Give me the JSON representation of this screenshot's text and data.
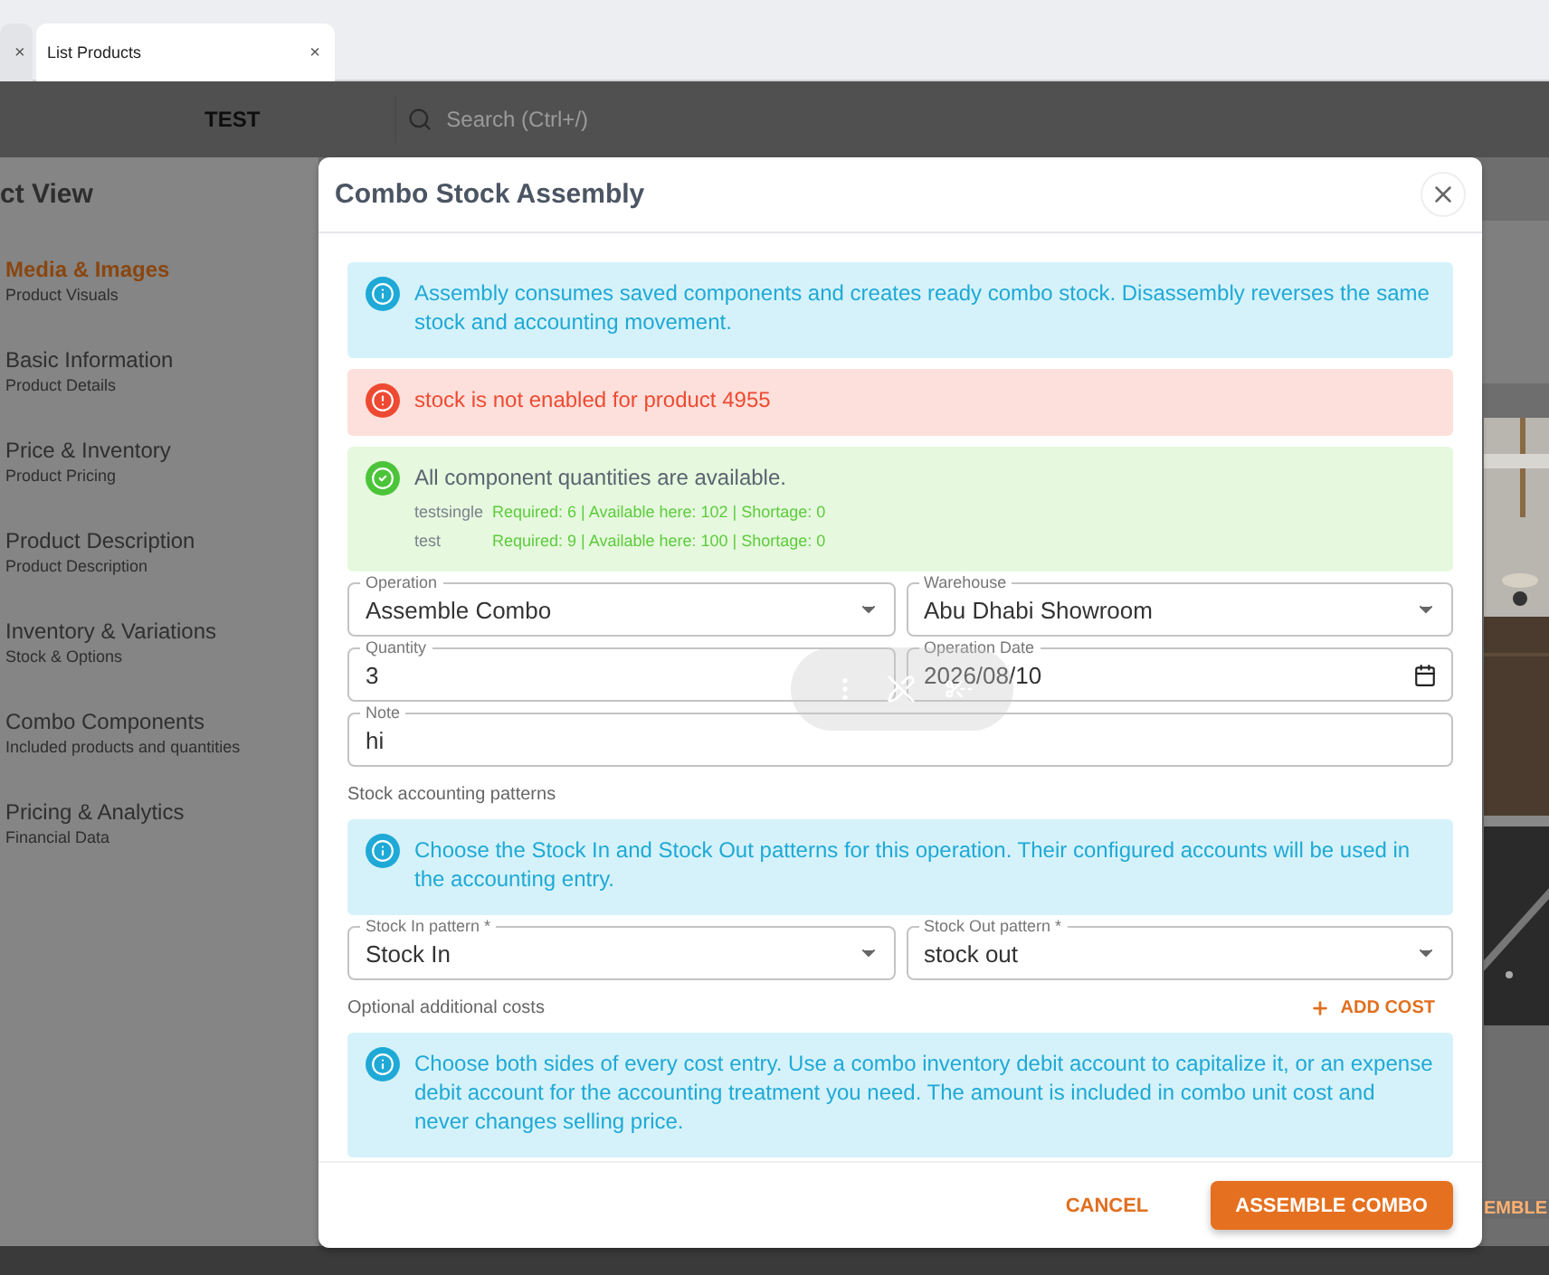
{
  "browser_tabs": [
    {
      "close_glyph": "×",
      "selected": false
    },
    {
      "label": "List Products",
      "close_glyph": "×",
      "selected": true
    }
  ],
  "header": {
    "title": "TEST",
    "search_placeholder": "Search (Ctrl+/)"
  },
  "page": {
    "heading": "ct View",
    "button_fragment": "EMBLE",
    "sections": [
      {
        "title": "Media & Images",
        "subtitle": "Product Visuals",
        "selected": true
      },
      {
        "title": "Basic Information",
        "subtitle": "Product Details",
        "selected": false
      },
      {
        "title": "Price & Inventory",
        "subtitle": "Product Pricing",
        "selected": false
      },
      {
        "title": "Product Description",
        "subtitle": "Product Description",
        "selected": false
      },
      {
        "title": "Inventory & Variations",
        "subtitle": "Stock & Options",
        "selected": false
      },
      {
        "title": "Combo Components",
        "subtitle": "Included products and quantities",
        "selected": false
      },
      {
        "title": "Pricing & Analytics",
        "subtitle": "Financial Data",
        "selected": false
      }
    ]
  },
  "dialog": {
    "title": "Combo Stock Assembly",
    "blocks": [
      {
        "kind": "info_alert",
        "text": "Assembly consumes saved components and creates ready combo stock. Disassembly reverses the same stock and accounting movement."
      },
      {
        "kind": "error_alert",
        "text": "stock is not enabled for product 4955"
      },
      {
        "kind": "success_alert",
        "text": "All component quantities are available.",
        "lines": [
          {
            "name": "testsingle",
            "detail": "Required: 6 | Available here: 102 | Shortage: 0"
          },
          {
            "name": "test",
            "detail": "Required: 9 | Available here: 100 | Shortage: 0"
          }
        ]
      },
      {
        "kind": "fields",
        "fields": [
          {
            "label": "Operation",
            "value": "Assemble Combo",
            "kind": "select"
          },
          {
            "label": "Warehouse",
            "value": "Abu Dhabi Showroom",
            "kind": "select"
          }
        ]
      },
      {
        "kind": "fields",
        "fields": [
          {
            "label": "Quantity",
            "value": "3",
            "kind": "text"
          },
          {
            "label": "Operation Date",
            "value": "2026/08/10",
            "kind": "date"
          }
        ]
      },
      {
        "kind": "fields",
        "fields": [
          {
            "label": "Note",
            "value": "hi",
            "kind": "text"
          }
        ]
      },
      {
        "kind": "heading",
        "text": "Stock accounting patterns"
      },
      {
        "kind": "info_alert",
        "text": "Choose the Stock In and Stock Out patterns for this operation. Their configured accounts will be used in the accounting entry."
      },
      {
        "kind": "fields",
        "fields": [
          {
            "label": "Stock In pattern *",
            "value": "Stock In",
            "kind": "select"
          },
          {
            "label": "Stock Out pattern *",
            "value": "stock out",
            "kind": "select"
          }
        ]
      },
      {
        "kind": "heading",
        "text": "Optional additional costs",
        "action": "ADD COST"
      },
      {
        "kind": "info_alert",
        "text": "Choose both sides of every cost entry. Use a combo inventory debit account to capitalize it, or an expense debit account for the accounting treatment you need. The amount is included in combo unit cost and never changes selling price."
      }
    ],
    "buttons": [
      {
        "label": "CANCEL",
        "kind": "text"
      },
      {
        "label": "ASSEMBLE COMBO",
        "kind": "primary"
      }
    ]
  }
}
